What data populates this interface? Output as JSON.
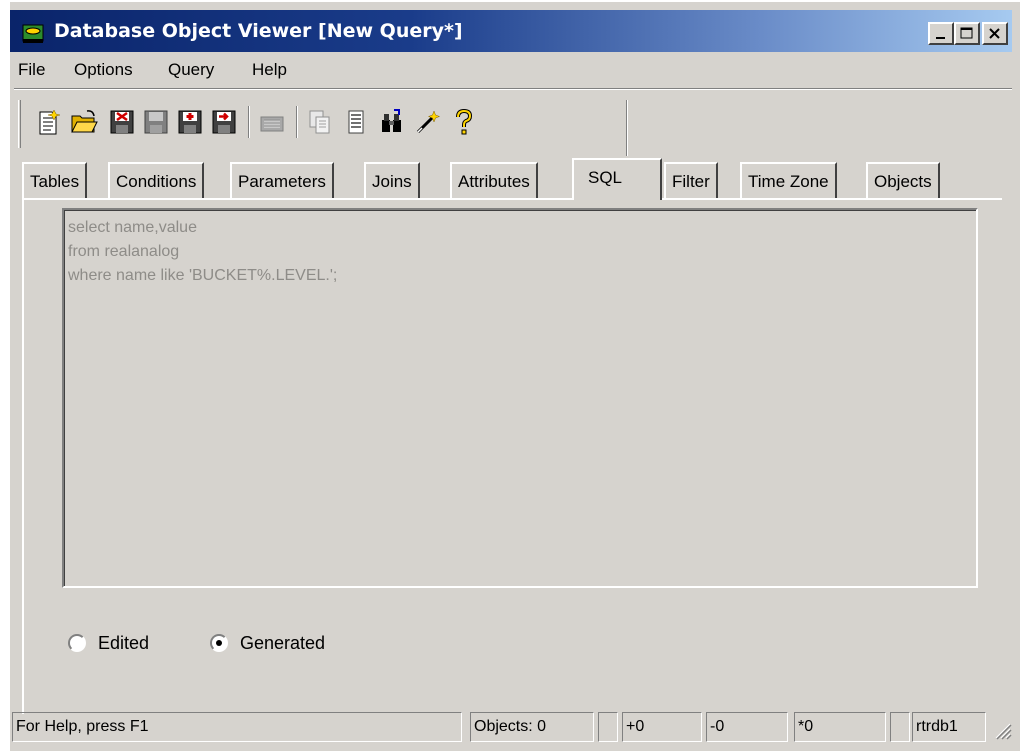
{
  "window": {
    "title": "Database Object Viewer [New Query*]"
  },
  "menu": {
    "items": [
      "File",
      "Options",
      "Query",
      "Help"
    ]
  },
  "toolbar": {
    "icons": [
      "new-query-icon",
      "open-folder-icon",
      "save-delete-icon",
      "save-icon",
      "save-add-icon",
      "save-export-icon",
      "camera-icon",
      "copy-icon",
      "list-icon",
      "binoculars-icon",
      "magic-wand-icon",
      "help-icon"
    ]
  },
  "tabs": [
    "Tables",
    "Conditions",
    "Parameters",
    "Joins",
    "Attributes",
    "SQL",
    "Filter",
    "Time Zone",
    "Objects"
  ],
  "active_tab": "SQL",
  "sql": {
    "lines": [
      "select name,value",
      "from realanalog",
      "where name like 'BUCKET%.LEVEL.';"
    ]
  },
  "radios": {
    "edited": {
      "label": "Edited",
      "checked": false
    },
    "generated": {
      "label": "Generated",
      "checked": true
    }
  },
  "status": {
    "help": "For Help, press F1",
    "objects": "Objects: 0",
    "plus": "+0",
    "minus": "-0",
    "star": "*0",
    "db": "rtrdb1"
  }
}
